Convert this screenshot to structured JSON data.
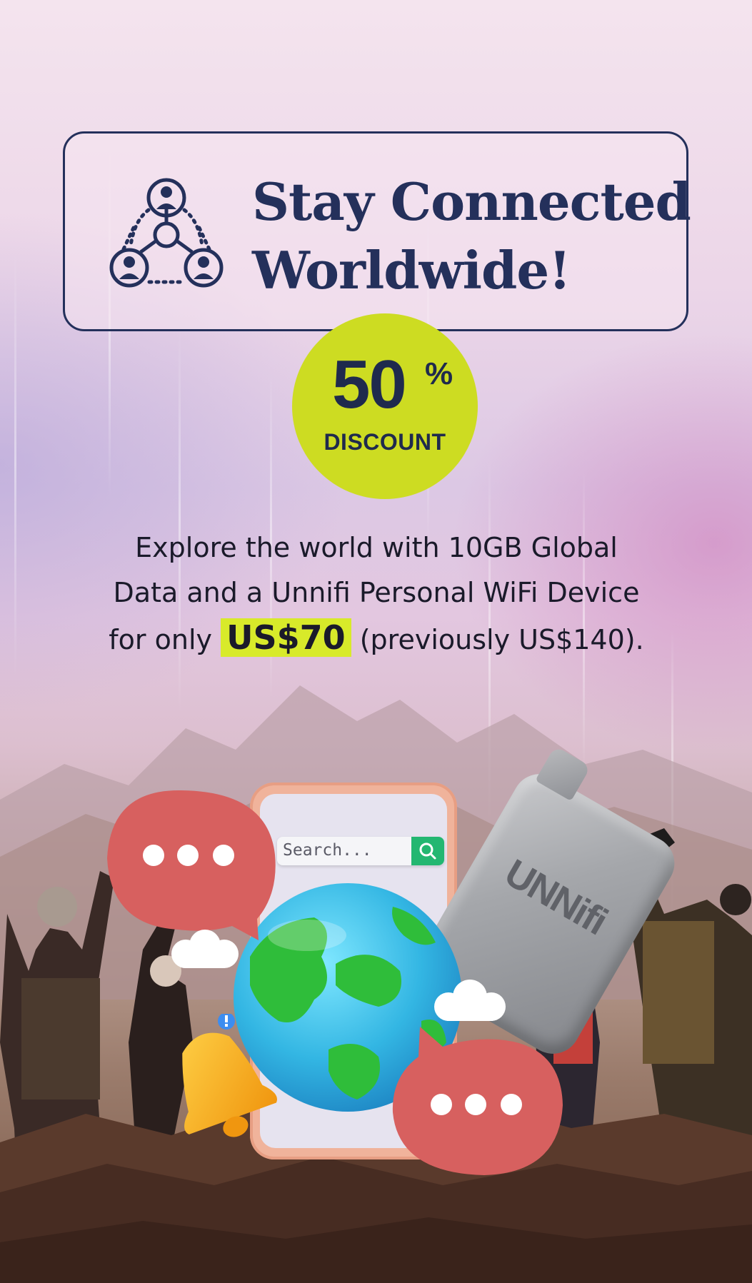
{
  "headline": {
    "line1": "Stay Connected",
    "line2": "Worldwide!"
  },
  "badge": {
    "number": "50",
    "percent_sign": "%",
    "label": "DISCOUNT"
  },
  "description": {
    "line1": "Explore the world with 10GB Global",
    "line2": "Data and a Unnifi Personal WiFi Device",
    "line3_prefix": "for only",
    "price": "US$70",
    "line3_suffix": "(previously US$140)."
  },
  "phone": {
    "search_placeholder": "Search..."
  },
  "router": {
    "logo": "UNNifi"
  },
  "icons": {
    "header": "people-network-icon",
    "search": "magnifier-icon",
    "bell": "bell-icon",
    "chat": "chat-bubble-icon"
  },
  "colors": {
    "navy": "#24305b",
    "lime": "#cddc22",
    "price_highlight": "#d8ea2a",
    "bubble": "#d7605f",
    "search_green": "#23b771"
  }
}
